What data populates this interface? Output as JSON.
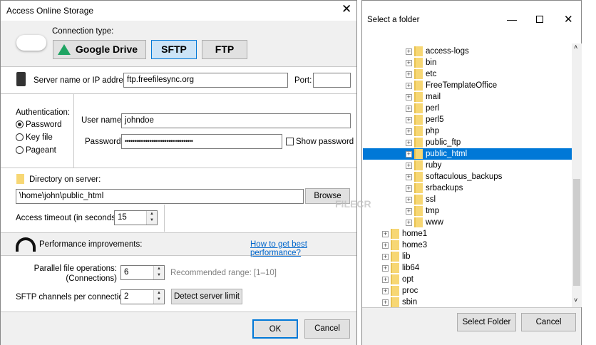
{
  "left": {
    "title": "Access Online Storage",
    "connection_type_label": "Connection type:",
    "types": [
      "Google Drive",
      "SFTP",
      "FTP"
    ],
    "server_label": "Server name or IP address:",
    "server_value": "ftp.freefilesync.org",
    "port_label": "Port:",
    "port_value": "",
    "auth_label": "Authentication:",
    "auth_options": [
      "Password",
      "Key file",
      "Pageant"
    ],
    "user_label": "User name:",
    "user_value": "johndoe",
    "password_label": "Password:",
    "password_value": "••••••••••••••••••••••••••••••••••••",
    "show_password": "Show password",
    "dir_label": "Directory on server:",
    "dir_value": "\\home\\john\\public_html",
    "browse": "Browse",
    "timeout_label": "Access timeout (in seconds):",
    "timeout_value": "15",
    "perf_label": "Performance improvements:",
    "perf_link": "How to get best performance?",
    "parallel_label1": "Parallel file operations:",
    "parallel_label2": "(Connections)",
    "parallel_value": "6",
    "recommended": "Recommended range: [1–10]",
    "channels_label": "SFTP channels per connection:",
    "channels_value": "2",
    "detect": "Detect server limit",
    "ok": "OK",
    "cancel": "Cancel"
  },
  "right": {
    "title": "Select a folder",
    "sub_items": [
      "access-logs",
      "bin",
      "etc",
      "FreeTemplateOffice",
      "mail",
      "perl",
      "perl5",
      "php",
      "public_ftp",
      "public_html",
      "ruby",
      "softaculous_backups",
      "srbackups",
      "ssl",
      "tmp",
      "www"
    ],
    "selected": "public_html",
    "top_items": [
      "home1",
      "home3",
      "lib",
      "lib64",
      "opt",
      "proc",
      "sbin"
    ],
    "select_button": "Select Folder",
    "cancel": "Cancel"
  },
  "colors": {
    "accent": "#0078d7",
    "selected_bg": "#0078d7",
    "link": "#0066cc"
  }
}
